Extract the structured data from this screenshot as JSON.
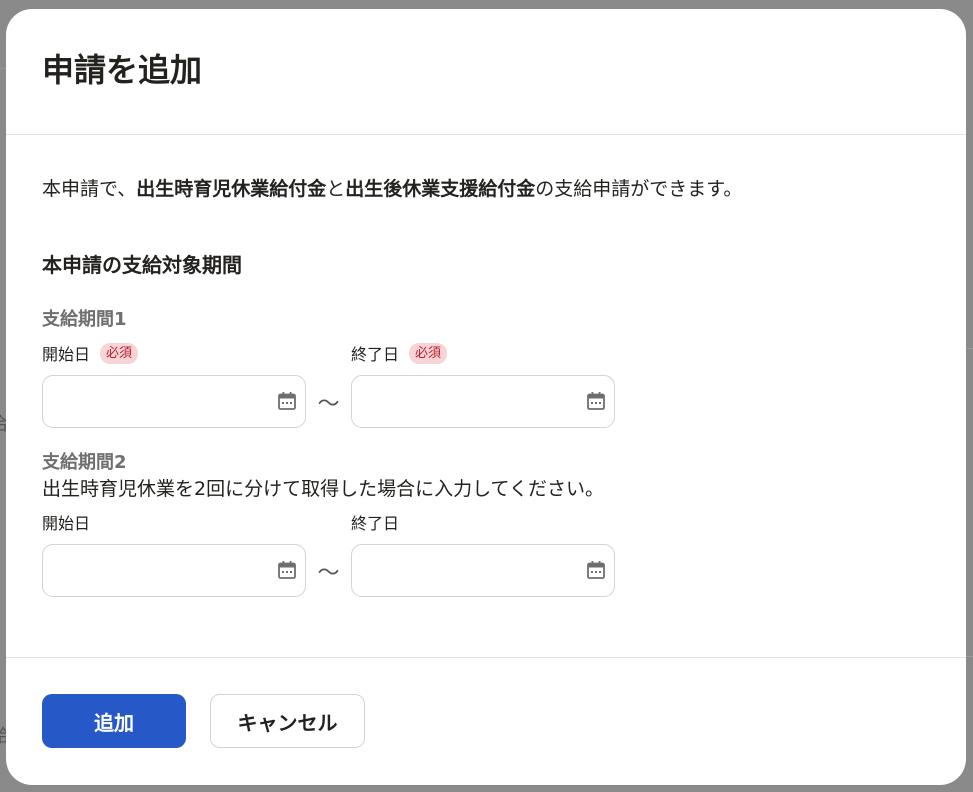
{
  "background": {
    "glyph_1": "合",
    "glyph_2": "給"
  },
  "dialog": {
    "title": "申請を追加",
    "description": {
      "prefix": "本申請で、",
      "benefit_1": "出生時育児休業給付金",
      "joiner": "と",
      "benefit_2": "出生後休業支援給付金",
      "suffix": "の支給申請ができます。"
    },
    "section_title": "本申請の支給対象期間",
    "period_1": {
      "label": "支給期間1",
      "start_label": "開始日",
      "end_label": "終了日",
      "required_badge": "必須",
      "start_value": "",
      "end_value": "",
      "separator": "〜"
    },
    "period_2": {
      "label": "支給期間2",
      "note": "出生時育児休業を2回に分けて取得した場合に入力してください。",
      "start_label": "開始日",
      "end_label": "終了日",
      "start_value": "",
      "end_value": "",
      "separator": "〜"
    },
    "footer": {
      "add_label": "追加",
      "cancel_label": "キャンセル"
    }
  },
  "colors": {
    "primary": "#2658c8",
    "badge_bg": "#f8d4d7",
    "badge_text": "#b3202d",
    "overlay": "#8a8a8a"
  },
  "icons": {
    "date_picker": "calendar-icon"
  }
}
